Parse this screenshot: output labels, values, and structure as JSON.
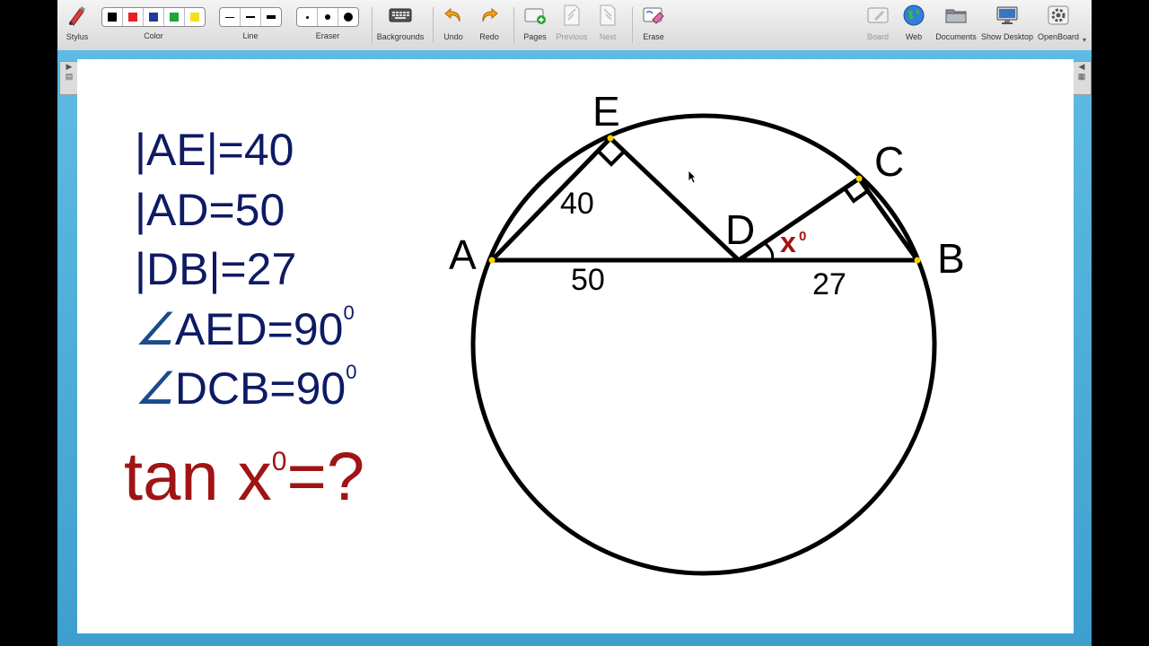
{
  "toolbar": {
    "stylus": "Stylus",
    "color": "Color",
    "line": "Line",
    "eraser": "Eraser",
    "backgrounds": "Backgrounds",
    "undo": "Undo",
    "redo": "Redo",
    "pages": "Pages",
    "previous": "Previous",
    "next": "Next",
    "erase": "Erase",
    "board": "Board",
    "web": "Web",
    "documents": "Documents",
    "show_desktop": "Show Desktop",
    "openboard": "OpenBoard",
    "colors": [
      "#000000",
      "#e8201c",
      "#1e3a9a",
      "#22a43a",
      "#f2e01c"
    ]
  },
  "board": {
    "given": {
      "ae": "|AE|=40",
      "ad": "|AD=50",
      "db": "|DB|=27",
      "aed": "AED=90",
      "dcb": "DCB=90",
      "angle_symbol": "∠",
      "degree": "0"
    },
    "question": {
      "text": "tan x",
      "degree": "0",
      "tail": "=?"
    },
    "diagram": {
      "point_labels": {
        "a": "A",
        "b": "B",
        "c": "C",
        "d": "D",
        "e": "E"
      },
      "segment_labels": {
        "ae": "40",
        "ad": "50",
        "db": "27"
      },
      "angle_label": "x",
      "angle_degree": "0",
      "colors": {
        "ink": "#000000",
        "accent": "#a01414",
        "point": "#f5d000"
      }
    }
  }
}
